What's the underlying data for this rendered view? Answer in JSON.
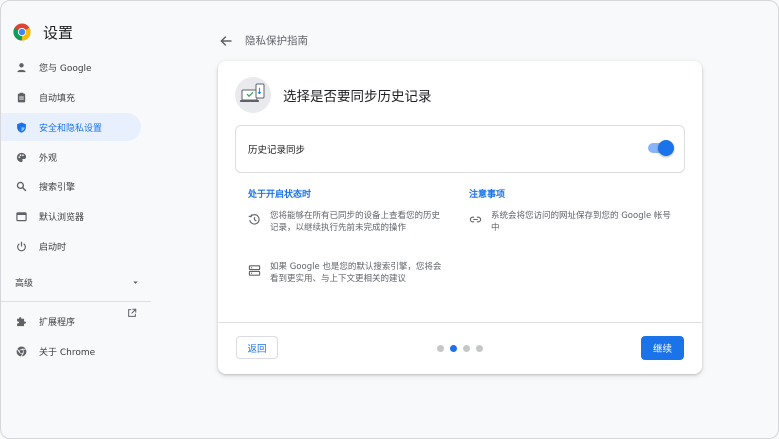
{
  "sidebar": {
    "title": "设置",
    "items": [
      {
        "label": "您与 Google",
        "icon": "person-icon"
      },
      {
        "label": "自动填充",
        "icon": "clipboard-icon"
      },
      {
        "label": "安全和隐私设置",
        "icon": "shield-icon",
        "active": true
      },
      {
        "label": "外观",
        "icon": "palette-icon"
      },
      {
        "label": "搜索引擎",
        "icon": "search-icon"
      },
      {
        "label": "默认浏览器",
        "icon": "browser-icon"
      },
      {
        "label": "启动时",
        "icon": "power-icon"
      }
    ],
    "advanced_label": "高级",
    "extensions_label": "扩展程序",
    "about_label": "关于 Chrome"
  },
  "header": {
    "breadcrumb": "隐私保护指南"
  },
  "card": {
    "title": "选择是否要同步历史记录",
    "toggle_label": "历史记录同步",
    "toggle_on": true,
    "left_heading": "处于开启状态时",
    "left_items": [
      {
        "icon": "history-icon",
        "text": "您将能够在所有已同步的设备上查看您的历史记录，以继续执行先前未完成的操作"
      },
      {
        "icon": "storage-icon",
        "text": "如果 Google 也是您的默认搜索引擎，您将会看到更实用、与上下文更相关的建议"
      }
    ],
    "right_heading": "注意事项",
    "right_items": [
      {
        "icon": "link-icon",
        "text": "系统会将您访问的网址保存到您的 Google 帐号中"
      }
    ],
    "back_button": "返回",
    "next_button": "继续",
    "step_count": 4,
    "current_step": 2
  },
  "colors": {
    "accent": "#1a73e8",
    "active_nav_bg": "#e8f0fe",
    "text_secondary": "#5f6368"
  }
}
